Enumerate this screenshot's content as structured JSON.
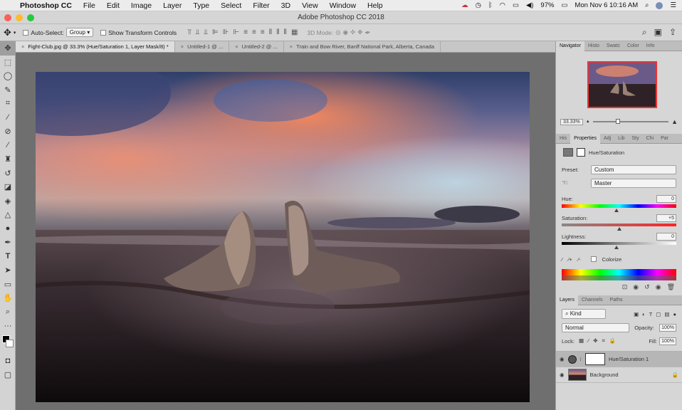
{
  "menubar": {
    "app": "Photoshop CC",
    "items": [
      "File",
      "Edit",
      "Image",
      "Layer",
      "Type",
      "Select",
      "Filter",
      "3D",
      "View",
      "Window",
      "Help"
    ],
    "battery": "97%",
    "clock": "Mon Nov 6  10:16 AM"
  },
  "titlebar": {
    "title": "Adobe Photoshop CC 2018"
  },
  "options": {
    "auto_select_label": "Auto-Select:",
    "auto_select_value": "Group",
    "show_transform_label": "Show Transform Controls",
    "mode_3d_label": "3D Mode:"
  },
  "tabs": [
    {
      "label": "Fight-Club.jpg @ 33.3% (Hue/Saturation 1, Layer Mask/8) *"
    },
    {
      "label": "Untitled-1 @ ..."
    },
    {
      "label": "Untitled-2 @ ..."
    },
    {
      "label": "Train and Bow River, Banff National Park, Alberta, Canada"
    }
  ],
  "navigator": {
    "tabs": [
      "Navigator",
      "Histo",
      "Swatc",
      "Color",
      "Info"
    ],
    "zoom": "33.33%"
  },
  "properties": {
    "tabs": [
      "His",
      "Properties",
      "Adj",
      "Lib",
      "Sty",
      "Chi",
      "Par"
    ],
    "adjustment_name": "Hue/Saturation",
    "preset_label": "Preset:",
    "preset_value": "Custom",
    "channel_value": "Master",
    "hue_label": "Hue:",
    "hue_value": "0",
    "saturation_label": "Saturation:",
    "saturation_value": "+5",
    "lightness_label": "Lightness:",
    "lightness_value": "0",
    "colorize_label": "Colorize"
  },
  "layers": {
    "tabs": [
      "Layers",
      "Channels",
      "Paths"
    ],
    "filter_kind": "Kind",
    "blend_mode": "Normal",
    "opacity_label": "Opacity:",
    "opacity_value": "100%",
    "lock_label": "Lock:",
    "fill_label": "Fill:",
    "fill_value": "100%",
    "items": [
      {
        "name": "Hue/Saturation 1"
      },
      {
        "name": "Background"
      }
    ]
  },
  "icons": {
    "tools": [
      "move-icon",
      "marquee-icon",
      "lasso-icon",
      "quick-select-icon",
      "crop-icon",
      "eyedropper-icon",
      "healing-icon",
      "brush-icon",
      "stamp-icon",
      "history-brush-icon",
      "eraser-icon",
      "gradient-icon",
      "blur-icon",
      "dodge-icon",
      "pen-icon",
      "type-icon",
      "path-select-icon",
      "shape-icon",
      "hand-icon",
      "zoom-icon"
    ]
  }
}
